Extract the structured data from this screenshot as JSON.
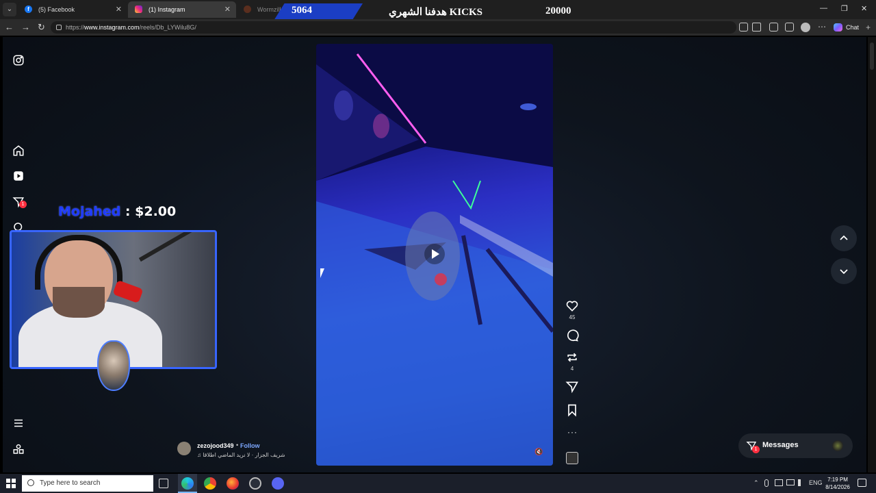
{
  "browser": {
    "tabs": [
      {
        "label": "(5) Facebook",
        "favicon": "facebook-icon",
        "active": false
      },
      {
        "label": "(1) Instagram",
        "favicon": "instagram-icon",
        "active": true
      },
      {
        "label": "Wormzilla.io -",
        "favicon": "wormzilla-icon",
        "active": false
      }
    ],
    "url_prefix": "https://",
    "url_host": "www.instagram.com",
    "url_path": "/reels/Db_LYWilu8G/",
    "chat_label": "Chat",
    "tab_menu_glyph": "⌄",
    "tab_close_glyph": "✕",
    "window_controls": {
      "minimize": "—",
      "restore": "❐",
      "close": "✕"
    },
    "nav_glyphs": {
      "back": "←",
      "forward": "→",
      "reload": "↻"
    },
    "more_glyph": "⋯",
    "sidebar_glyph": "+"
  },
  "stream_overlay": {
    "count": "5064",
    "goal_text": "هدفنا الشهري KICKS",
    "target": "20000",
    "donation_name": "Mojahed",
    "donation_amount": " : $2.00"
  },
  "instagram": {
    "sidebar": {
      "notifications_badge": "1"
    },
    "reel": {
      "username": "zezojood349",
      "separator": "•",
      "follow_label": "Follow",
      "audio": "♫ شريف الجزار · لا نريد الماضي اطلاقا",
      "mute_glyph": "🔇",
      "like_count": "45",
      "repost_count": "4",
      "more_glyph": "···"
    },
    "messages": {
      "label": "Messages",
      "badge": "1"
    },
    "accent_color": "#0095f6"
  },
  "taskbar": {
    "search_placeholder": "Type here to search",
    "language": "ENG",
    "time": "7:19 PM",
    "date": "8/14/2026",
    "tray_chevron": "⌃"
  }
}
